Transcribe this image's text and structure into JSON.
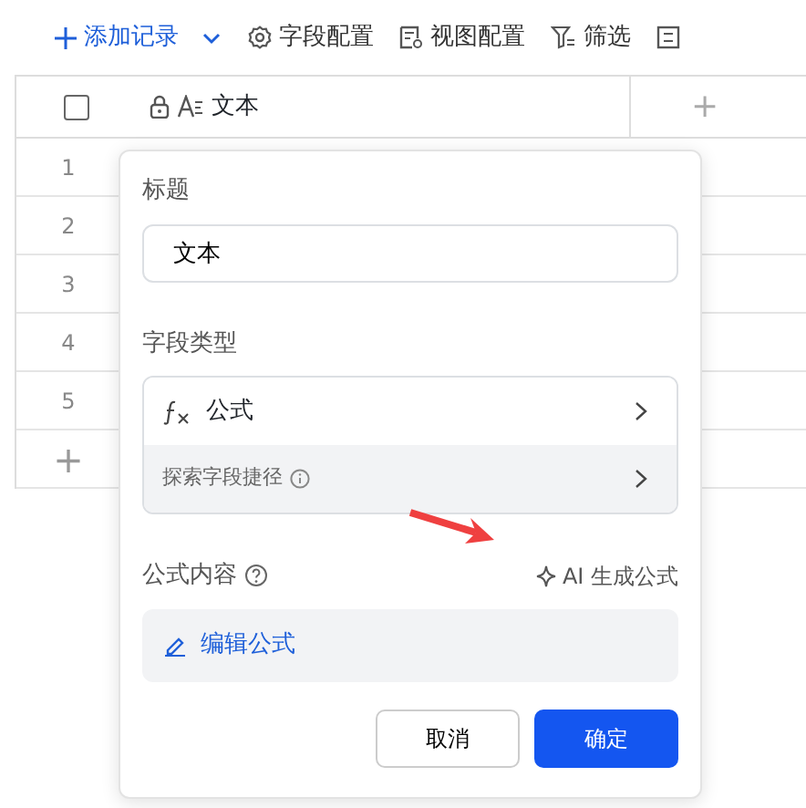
{
  "toolbar": [
    {
      "kind": "add",
      "label": "添加记录"
    },
    {
      "kind": "settings",
      "label": "字段配置"
    },
    {
      "kind": "view",
      "label": "视图配置"
    },
    {
      "kind": "filter",
      "label": "筛选"
    },
    {
      "kind": "group"
    }
  ],
  "header": {
    "checked": false,
    "column": "文本",
    "add": "+"
  },
  "rows": [
    "1",
    "2",
    "3",
    "4",
    "5"
  ],
  "add_row": "+",
  "popover": {
    "title_label": "标题",
    "title_value": "文本",
    "type_label": "字段类型",
    "type_value": "公式",
    "explore": "探索字段捷径",
    "formula_label": "公式内容",
    "ai_button": "AI 生成公式",
    "edit_formula": "编辑公式",
    "buttons": [
      {
        "kind": "secondary",
        "label": "取消"
      },
      {
        "kind": "primary",
        "label": "确定"
      }
    ]
  }
}
